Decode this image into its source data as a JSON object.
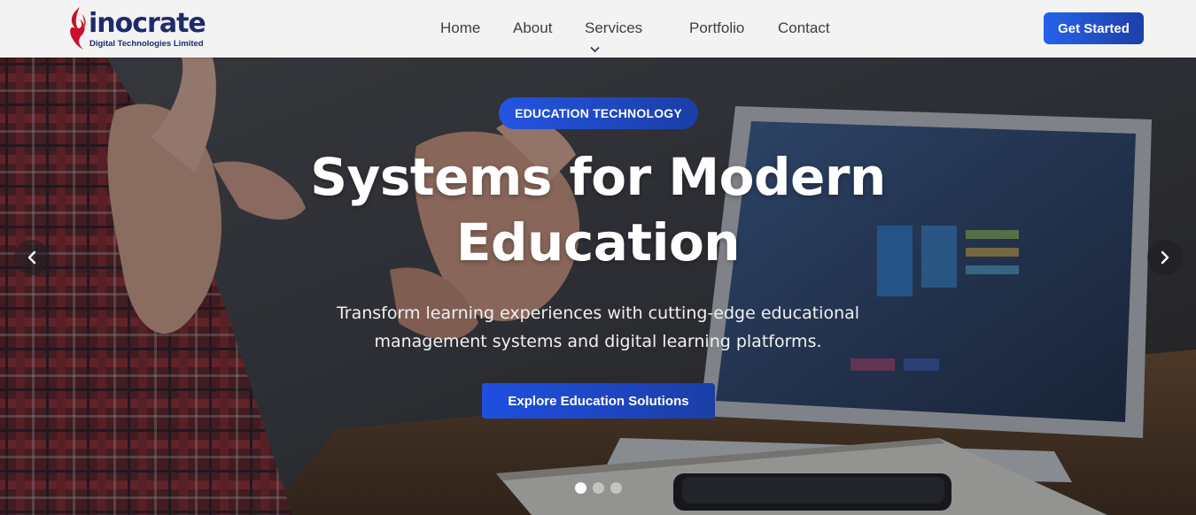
{
  "brand": {
    "name": "inocrate",
    "tagline": "Digital Technologies Limited",
    "colors": {
      "navy": "#1f2a6b",
      "flame": "#c8102e",
      "accent": "#2563eb"
    }
  },
  "nav": {
    "items": [
      {
        "label": "Home"
      },
      {
        "label": "About"
      },
      {
        "label": "Services",
        "icon": "chevron-down-icon"
      },
      {
        "label": "Portfolio"
      },
      {
        "label": "Contact"
      }
    ],
    "cta_label": "Get Started"
  },
  "hero": {
    "badge": "EDUCATION TECHNOLOGY",
    "title": "Systems for Modern Education",
    "subtitle": "Transform learning experiences with cutting-edge educational management systems and digital learning platforms.",
    "cta_label": "Explore Education Solutions",
    "prev_icon": "chevron-left-icon",
    "next_icon": "chevron-right-icon",
    "slides": {
      "count": 3,
      "active_index": 0
    }
  }
}
